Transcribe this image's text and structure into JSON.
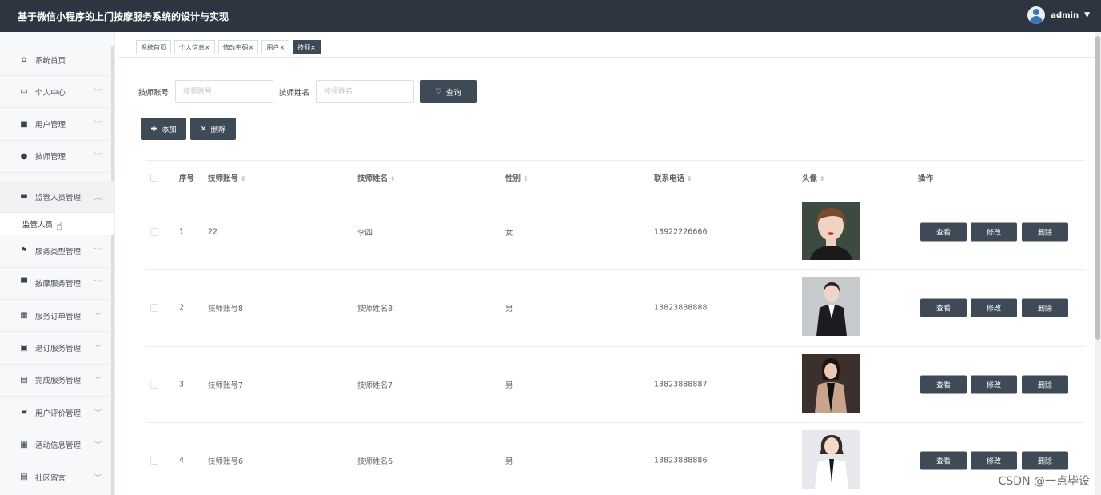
{
  "header": {
    "title": "基于微信小程序的上门按摩服务系统的设计与实现",
    "user_name": "admin"
  },
  "sidebar": {
    "items": [
      {
        "label": "系统首页",
        "icon": "home-icon",
        "chevron": false
      },
      {
        "label": "个人中心",
        "icon": "id-card-icon",
        "chevron": true
      },
      {
        "label": "用户管理",
        "icon": "users-icon",
        "chevron": true
      },
      {
        "label": "技师管理",
        "icon": "user-icon",
        "chevron": true
      },
      {
        "label": "监管人员管理",
        "icon": "ticket-icon",
        "chevron": true,
        "open": true
      },
      {
        "label": "服务类型管理",
        "icon": "flag-icon",
        "chevron": true
      },
      {
        "label": "按摩服务管理",
        "icon": "monitor-icon",
        "chevron": true
      },
      {
        "label": "服务订单管理",
        "icon": "grid-icon",
        "chevron": true
      },
      {
        "label": "退订服务管理",
        "icon": "chart-icon",
        "chevron": true
      },
      {
        "label": "完成服务管理",
        "icon": "clipboard-icon",
        "chevron": true
      },
      {
        "label": "用户评价管理",
        "icon": "briefcase-icon",
        "chevron": true
      },
      {
        "label": "活动信息管理",
        "icon": "grid-icon",
        "chevron": true
      },
      {
        "label": "社区留言",
        "icon": "clipboard-icon",
        "chevron": true
      }
    ],
    "submenu_label": "监管人员"
  },
  "tabs": [
    {
      "label": "系统首页",
      "active": false
    },
    {
      "label": "个人信息×",
      "active": false
    },
    {
      "label": "修改密码×",
      "active": false
    },
    {
      "label": "用户×",
      "active": false
    },
    {
      "label": "技师×",
      "active": true
    }
  ],
  "search": {
    "account_label": "技师账号",
    "account_placeholder": "技师账号",
    "name_label": "技师姓名",
    "name_placeholder": "技师姓名",
    "query_button": "查询"
  },
  "actions": {
    "add_label": "添加",
    "delete_label": "删除"
  },
  "table": {
    "headers": {
      "index": "序号",
      "account": "技师账号",
      "name": "技师姓名",
      "gender": "性别",
      "phone": "联系电话",
      "avatar": "头像",
      "ops": "操作"
    },
    "rows": [
      {
        "index": "1",
        "account": "22",
        "name": "李四",
        "gender": "女",
        "phone": "13922226666"
      },
      {
        "index": "2",
        "account": "技师账号8",
        "name": "技师姓名8",
        "gender": "男",
        "phone": "13823888888"
      },
      {
        "index": "3",
        "account": "技师账号7",
        "name": "技师姓名7",
        "gender": "男",
        "phone": "13823888887"
      },
      {
        "index": "4",
        "account": "技师账号6",
        "name": "技师姓名6",
        "gender": "男",
        "phone": "13823888886"
      }
    ],
    "row_buttons": {
      "view": "查看",
      "edit": "修改",
      "delete": "删除"
    }
  },
  "watermark": "CSDN @一点毕设",
  "colors": {
    "header_bg": "#2d3540",
    "button_bg": "#3f4a57"
  }
}
